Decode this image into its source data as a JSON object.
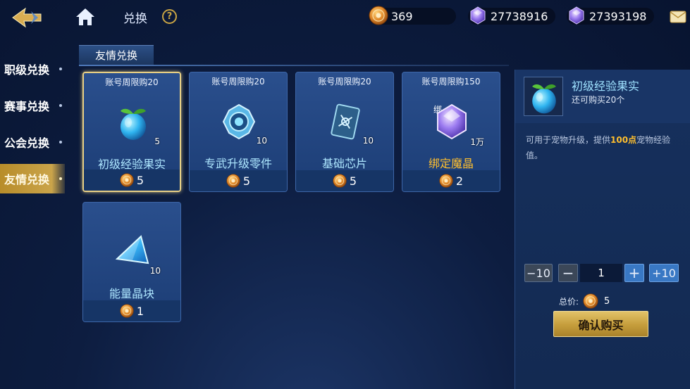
{
  "header": {
    "title": "兑换",
    "help_label": "?",
    "currencies": [
      {
        "name": "coin",
        "value": "369"
      },
      {
        "name": "purple-gem",
        "value": "27738916"
      },
      {
        "name": "purple-gem-bound",
        "value": "27393198"
      }
    ]
  },
  "leftnav": {
    "items": [
      {
        "label": "职级兑换",
        "active": false
      },
      {
        "label": "赛事兑换",
        "active": false
      },
      {
        "label": "公会兑换",
        "active": false
      },
      {
        "label": "友情兑换",
        "active": true
      }
    ]
  },
  "subtab": {
    "label": "友情兑换"
  },
  "items": [
    {
      "limit": "账号周限购20",
      "name": "初级经验果实",
      "qty": "5",
      "price": "5",
      "icon": "green-fruit-icon",
      "selected": true
    },
    {
      "limit": "账号周限购20",
      "name": "专武升级零件",
      "qty": "10",
      "price": "5",
      "icon": "gear-part-icon",
      "selected": false
    },
    {
      "limit": "账号周限购20",
      "name": "基础芯片",
      "qty": "10",
      "price": "5",
      "icon": "chip-card-icon",
      "selected": false
    },
    {
      "limit": "账号周限购150",
      "name": "绑定魔晶",
      "qty": "1万",
      "price": "2",
      "icon": "purple-crystal-icon",
      "tag": "绑",
      "selected": false
    },
    {
      "limit": "",
      "name": "能量晶块",
      "qty": "10",
      "price": "1",
      "icon": "energy-crystal-icon",
      "selected": false
    }
  ],
  "detail": {
    "name": "初级经验果实",
    "remaining": "还可购买20个",
    "desc_pre": "可用于宠物升级，提供",
    "desc_highlight": "100点",
    "desc_post": "宠物经验值。",
    "quantity": "1",
    "minus10_label": "−10",
    "minus_label": "−",
    "plus_label": "+",
    "plus10_label": "+10",
    "total_label": "总价:",
    "total_value": "5",
    "buy_label": "确认购买"
  },
  "colors": {
    "accent_gold": "#c9a444",
    "name_blue": "#aee7ff",
    "highlight_orange": "#ffbf2e"
  }
}
